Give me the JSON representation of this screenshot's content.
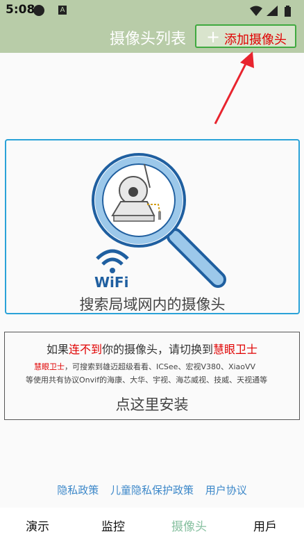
{
  "status_bar": {
    "time": "5:08",
    "notification_letter": "A",
    "icons": [
      "wifi-icon",
      "signal-icon",
      "battery-icon"
    ]
  },
  "header": {
    "title": "摄像头列表",
    "add_button_label": "添加摄像头"
  },
  "search_card": {
    "logo_text": "WiFi",
    "label": "搜索局域网内的摄像头"
  },
  "install_card": {
    "line1_prefix": "如果",
    "line1_highlight": "连不到",
    "line1_middle": "你的摄像头，请切换到",
    "line1_app": "慧眼卫士",
    "line2_app": "慧眼卫士",
    "line2_text": "，可搜索到雄迈超级看看、ICSee、宏视V380、XiaoVV",
    "line3_text": "等使用共有协议Onvif的海康、大华、宇视、海芯威视、技威、天视通等",
    "button_label": "点这里安装"
  },
  "footer": {
    "links": [
      "隐私政策",
      "儿童隐私保护政策",
      "用户协议"
    ]
  },
  "tabs": [
    {
      "label": "演示",
      "active": false
    },
    {
      "label": "监控",
      "active": false
    },
    {
      "label": "摄像头",
      "active": true
    },
    {
      "label": "用戶",
      "active": false
    }
  ],
  "colors": {
    "header_bg": "#b8cca8",
    "accent_red": "#e00000",
    "card_border": "#2aa2d8",
    "link_blue": "#3d88c9",
    "active_tab": "#87c0a0"
  }
}
